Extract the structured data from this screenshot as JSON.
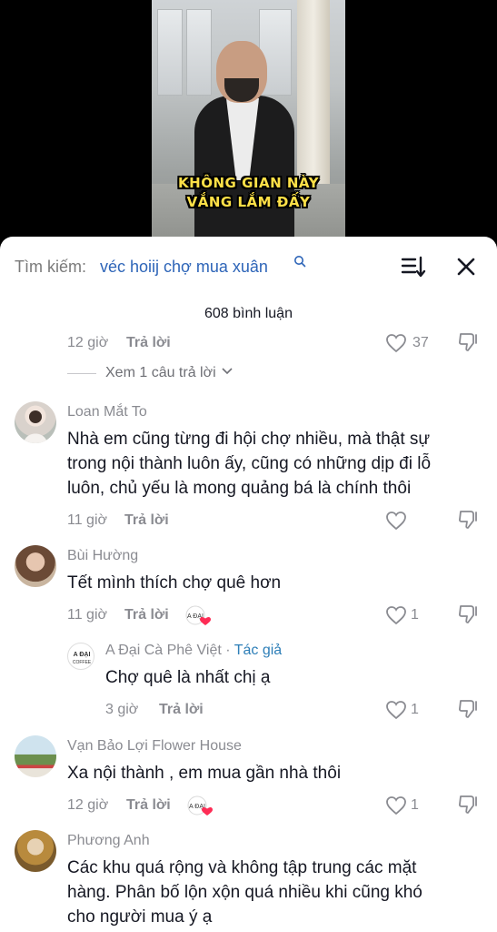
{
  "video": {
    "caption_line1": "KHÔNG GIAN NÀY",
    "caption_line2": "VẮNG LẮM ĐẤY"
  },
  "search": {
    "label": "Tìm kiếm:",
    "query": "véc hoiij chợ mua xuân"
  },
  "comments_count": "608 bình luận",
  "top_partial": {
    "time": "12 giờ",
    "reply": "Trả lời",
    "likes": "37",
    "view_replies": "Xem 1 câu trả lời"
  },
  "comments": [
    {
      "username": "Loan Mắt To",
      "lines": [
        "Nhà em cũng từng đi hội chợ nhiều, mà thật sự",
        "trong nội thành luôn ấy, cũng có những dịp đi lỗ",
        "luôn, chủ yếu là mong quảng bá là chính thôi"
      ],
      "time": "11 giờ",
      "reply": "Trả lời"
    },
    {
      "username": "Bùi Hường",
      "text": "Tết mình thích chợ quê hơn",
      "time": "11 giờ",
      "reply": "Trả lời",
      "likes": "1"
    },
    {
      "username": "A Đại Cà Phê Việt",
      "author_tag": "Tác giả",
      "author_sep": " · ",
      "text": "Chợ quê là nhất chị ạ",
      "time": "3 giờ",
      "reply": "Trả lời",
      "likes": "1"
    },
    {
      "username": "Vạn Bảo Lợi Flower House",
      "text": "Xa nội thành , em mua gần nhà thôi",
      "time": "12 giờ",
      "reply": "Trả lời",
      "likes": "1"
    },
    {
      "username": "Phương Anh",
      "lines": [
        "Các khu quá rộng và không tập trung các mặt",
        "hàng. Phân bố lộn xộn quá nhiều khi cũng khó",
        "cho người mua ý ạ"
      ]
    }
  ],
  "colors": {
    "accent_link": "#2e65b8",
    "author_tag": "#2e7fb8",
    "heart_red": "#fe2c55",
    "text_primary": "#161823",
    "text_secondary": "#8a8b91"
  },
  "icons": [
    "search-icon",
    "sort-icon",
    "close-icon",
    "heart-icon",
    "dislike-icon",
    "chevron-down-icon"
  ]
}
